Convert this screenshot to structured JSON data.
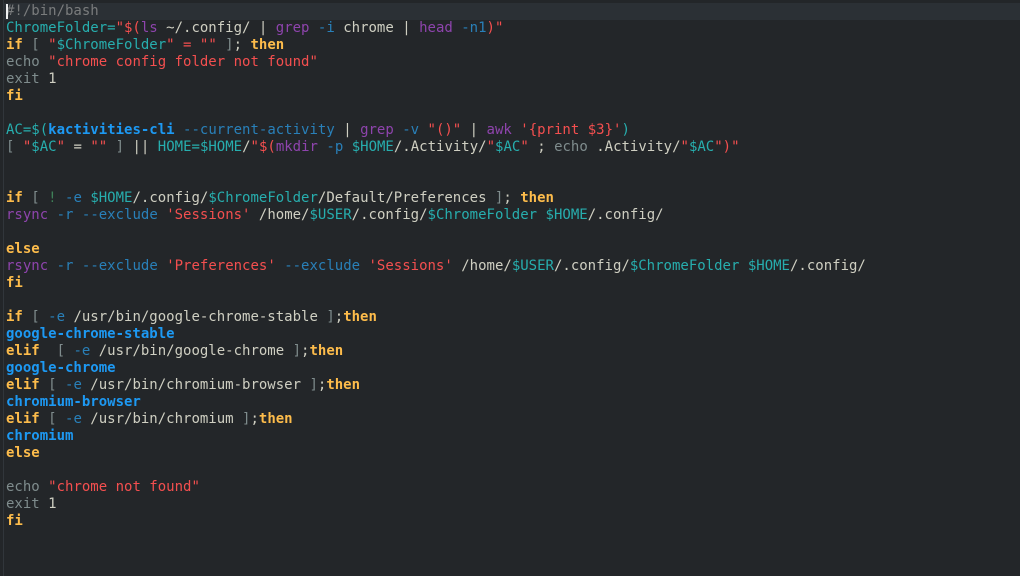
{
  "editor": {
    "colors": {
      "background": "#232629",
      "current_line": "#2b3035"
    },
    "lines": [
      [
        {
          "t": "#!/bin/bash",
          "c": "comment"
        }
      ],
      [
        {
          "t": "ChromeFolder=",
          "c": "var"
        },
        {
          "t": "\"$(",
          "c": "str"
        },
        {
          "t": "ls",
          "c": "prog"
        },
        {
          "t": " ~/.config/ ",
          "c": "text"
        },
        {
          "t": "|",
          "c": "text"
        },
        {
          "t": " ",
          "c": "text"
        },
        {
          "t": "grep",
          "c": "prog"
        },
        {
          "t": " ",
          "c": "text"
        },
        {
          "t": "-i",
          "c": "opt"
        },
        {
          "t": " chrome ",
          "c": "text"
        },
        {
          "t": "|",
          "c": "text"
        },
        {
          "t": " ",
          "c": "text"
        },
        {
          "t": "head",
          "c": "prog"
        },
        {
          "t": " ",
          "c": "text"
        },
        {
          "t": "-n1",
          "c": "opt"
        },
        {
          "t": ")\"",
          "c": "str"
        }
      ],
      [
        {
          "t": "if",
          "c": "kw"
        },
        {
          "t": " [ ",
          "c": "dim"
        },
        {
          "t": "\"",
          "c": "str"
        },
        {
          "t": "$ChromeFolder",
          "c": "var"
        },
        {
          "t": "\" = \"\"",
          "c": "str"
        },
        {
          "t": " ]",
          "c": "dim"
        },
        {
          "t": "; ",
          "c": "text"
        },
        {
          "t": "then",
          "c": "kw"
        }
      ],
      [
        {
          "t": "echo",
          "c": "builtin"
        },
        {
          "t": " ",
          "c": "text"
        },
        {
          "t": "\"chrome config folder not found\"",
          "c": "str"
        }
      ],
      [
        {
          "t": "exit",
          "c": "builtin"
        },
        {
          "t": " 1",
          "c": "text"
        }
      ],
      [
        {
          "t": "fi",
          "c": "kw"
        }
      ],
      [],
      [
        {
          "t": "AC=",
          "c": "var"
        },
        {
          "t": "$(",
          "c": "var"
        },
        {
          "t": "kactivities-cli",
          "c": "cmd"
        },
        {
          "t": " ",
          "c": "text"
        },
        {
          "t": "--current-activity",
          "c": "opt"
        },
        {
          "t": " ",
          "c": "text"
        },
        {
          "t": "|",
          "c": "text"
        },
        {
          "t": " ",
          "c": "text"
        },
        {
          "t": "grep",
          "c": "prog"
        },
        {
          "t": " ",
          "c": "text"
        },
        {
          "t": "-v",
          "c": "opt"
        },
        {
          "t": " ",
          "c": "text"
        },
        {
          "t": "\"()\"",
          "c": "str"
        },
        {
          "t": " ",
          "c": "text"
        },
        {
          "t": "|",
          "c": "text"
        },
        {
          "t": " ",
          "c": "text"
        },
        {
          "t": "awk",
          "c": "prog"
        },
        {
          "t": " ",
          "c": "text"
        },
        {
          "t": "'{print $3}'",
          "c": "str"
        },
        {
          "t": ")",
          "c": "var"
        }
      ],
      [
        {
          "t": "[ ",
          "c": "dim"
        },
        {
          "t": "\"",
          "c": "str"
        },
        {
          "t": "$AC",
          "c": "var"
        },
        {
          "t": "\"",
          "c": "str"
        },
        {
          "t": " = ",
          "c": "text"
        },
        {
          "t": "\"\"",
          "c": "str"
        },
        {
          "t": " ] ",
          "c": "dim"
        },
        {
          "t": "||",
          "c": "text"
        },
        {
          "t": " ",
          "c": "text"
        },
        {
          "t": "HOME=",
          "c": "var"
        },
        {
          "t": "$HOME",
          "c": "var"
        },
        {
          "t": "/",
          "c": "text"
        },
        {
          "t": "\"$(",
          "c": "str"
        },
        {
          "t": "mkdir",
          "c": "prog"
        },
        {
          "t": " ",
          "c": "text"
        },
        {
          "t": "-p",
          "c": "opt"
        },
        {
          "t": " ",
          "c": "text"
        },
        {
          "t": "$HOME",
          "c": "var"
        },
        {
          "t": "/.Activity/",
          "c": "text"
        },
        {
          "t": "\"",
          "c": "str"
        },
        {
          "t": "$AC",
          "c": "var"
        },
        {
          "t": "\"",
          "c": "str"
        },
        {
          "t": " ; ",
          "c": "text"
        },
        {
          "t": "echo",
          "c": "builtin"
        },
        {
          "t": " .Activity/",
          "c": "text"
        },
        {
          "t": "\"",
          "c": "str"
        },
        {
          "t": "$AC",
          "c": "var"
        },
        {
          "t": "\")\"",
          "c": "str"
        }
      ],
      [],
      [],
      [
        {
          "t": "if",
          "c": "kw"
        },
        {
          "t": " [ ",
          "c": "dim"
        },
        {
          "t": "!",
          "c": "op"
        },
        {
          "t": " ",
          "c": "text"
        },
        {
          "t": "-e",
          "c": "opt"
        },
        {
          "t": " ",
          "c": "text"
        },
        {
          "t": "$HOME",
          "c": "var"
        },
        {
          "t": "/.config/",
          "c": "text"
        },
        {
          "t": "$ChromeFolder",
          "c": "var"
        },
        {
          "t": "/Default/Preferences",
          "c": "text"
        },
        {
          "t": " ]",
          "c": "dim"
        },
        {
          "t": "; ",
          "c": "text"
        },
        {
          "t": "then",
          "c": "kw"
        }
      ],
      [
        {
          "t": "rsync",
          "c": "prog"
        },
        {
          "t": " ",
          "c": "text"
        },
        {
          "t": "-r",
          "c": "opt"
        },
        {
          "t": " ",
          "c": "text"
        },
        {
          "t": "--exclude",
          "c": "opt"
        },
        {
          "t": " ",
          "c": "text"
        },
        {
          "t": "'Sessions'",
          "c": "str"
        },
        {
          "t": " /home/",
          "c": "text"
        },
        {
          "t": "$USER",
          "c": "var"
        },
        {
          "t": "/.config/",
          "c": "text"
        },
        {
          "t": "$ChromeFolder",
          "c": "var"
        },
        {
          "t": " ",
          "c": "text"
        },
        {
          "t": "$HOME",
          "c": "var"
        },
        {
          "t": "/.config/",
          "c": "text"
        }
      ],
      [],
      [
        {
          "t": "else",
          "c": "kw"
        }
      ],
      [
        {
          "t": "rsync",
          "c": "prog"
        },
        {
          "t": " ",
          "c": "text"
        },
        {
          "t": "-r",
          "c": "opt"
        },
        {
          "t": " ",
          "c": "text"
        },
        {
          "t": "--exclude",
          "c": "opt"
        },
        {
          "t": " ",
          "c": "text"
        },
        {
          "t": "'Preferences'",
          "c": "str"
        },
        {
          "t": " ",
          "c": "text"
        },
        {
          "t": "--exclude",
          "c": "opt"
        },
        {
          "t": " ",
          "c": "text"
        },
        {
          "t": "'Sessions'",
          "c": "str"
        },
        {
          "t": " /home/",
          "c": "text"
        },
        {
          "t": "$USER",
          "c": "var"
        },
        {
          "t": "/.config/",
          "c": "text"
        },
        {
          "t": "$ChromeFolder",
          "c": "var"
        },
        {
          "t": " ",
          "c": "text"
        },
        {
          "t": "$HOME",
          "c": "var"
        },
        {
          "t": "/.config/",
          "c": "text"
        }
      ],
      [
        {
          "t": "fi",
          "c": "kw"
        }
      ],
      [],
      [
        {
          "t": "if",
          "c": "kw"
        },
        {
          "t": " [ ",
          "c": "dim"
        },
        {
          "t": "-e",
          "c": "opt"
        },
        {
          "t": " /usr/bin/google-chrome-stable",
          "c": "text"
        },
        {
          "t": " ]",
          "c": "dim"
        },
        {
          "t": ";",
          "c": "text"
        },
        {
          "t": "then",
          "c": "kw"
        }
      ],
      [
        {
          "t": "google-chrome-stable",
          "c": "cmd"
        }
      ],
      [
        {
          "t": "elif",
          "c": "kw"
        },
        {
          "t": "  [ ",
          "c": "dim"
        },
        {
          "t": "-e",
          "c": "opt"
        },
        {
          "t": " /usr/bin/google-chrome",
          "c": "text"
        },
        {
          "t": " ]",
          "c": "dim"
        },
        {
          "t": ";",
          "c": "text"
        },
        {
          "t": "then",
          "c": "kw"
        }
      ],
      [
        {
          "t": "google-chrome",
          "c": "cmd"
        }
      ],
      [
        {
          "t": "elif",
          "c": "kw"
        },
        {
          "t": " [ ",
          "c": "dim"
        },
        {
          "t": "-e",
          "c": "opt"
        },
        {
          "t": " /usr/bin/chromium-browser",
          "c": "text"
        },
        {
          "t": " ]",
          "c": "dim"
        },
        {
          "t": ";",
          "c": "text"
        },
        {
          "t": "then",
          "c": "kw"
        }
      ],
      [
        {
          "t": "chromium-browser",
          "c": "cmd"
        }
      ],
      [
        {
          "t": "elif",
          "c": "kw"
        },
        {
          "t": " [ ",
          "c": "dim"
        },
        {
          "t": "-e",
          "c": "opt"
        },
        {
          "t": " /usr/bin/chromium",
          "c": "text"
        },
        {
          "t": " ]",
          "c": "dim"
        },
        {
          "t": ";",
          "c": "text"
        },
        {
          "t": "then",
          "c": "kw"
        }
      ],
      [
        {
          "t": "chromium",
          "c": "cmd"
        }
      ],
      [
        {
          "t": "else",
          "c": "kw"
        }
      ],
      [],
      [
        {
          "t": "echo",
          "c": "builtin"
        },
        {
          "t": " ",
          "c": "text"
        },
        {
          "t": "\"chrome not found\"",
          "c": "str"
        }
      ],
      [
        {
          "t": "exit",
          "c": "builtin"
        },
        {
          "t": " 1",
          "c": "text"
        }
      ],
      [
        {
          "t": "fi",
          "c": "kw"
        }
      ]
    ]
  }
}
